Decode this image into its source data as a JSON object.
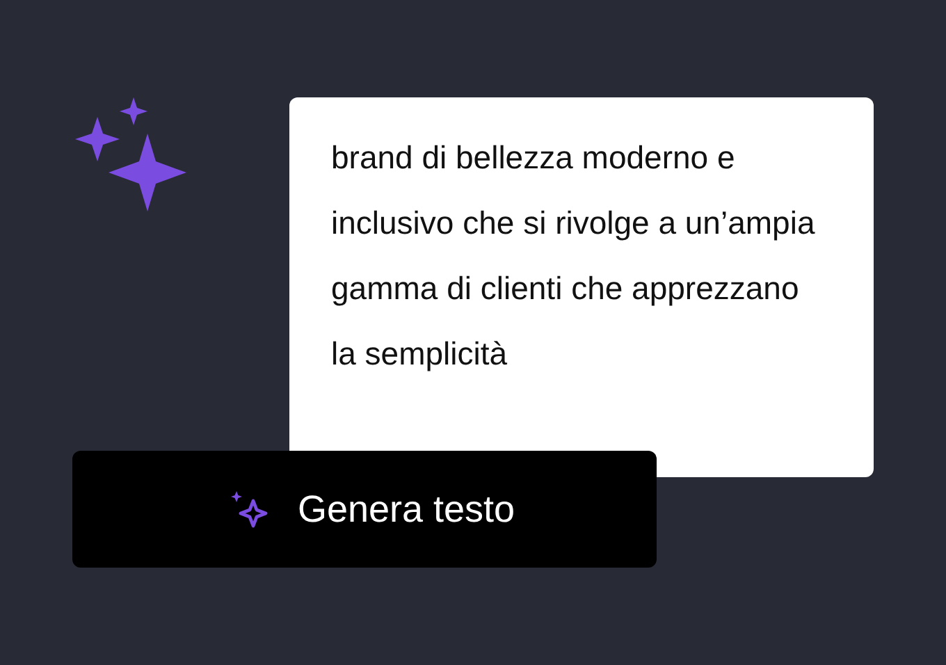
{
  "prompt": {
    "text": "brand di bellezza moderno e inclusivo che si rivolge a un’ampia gamma di clienti che apprezzano la semplicità"
  },
  "button": {
    "label": "Genera testo"
  }
}
